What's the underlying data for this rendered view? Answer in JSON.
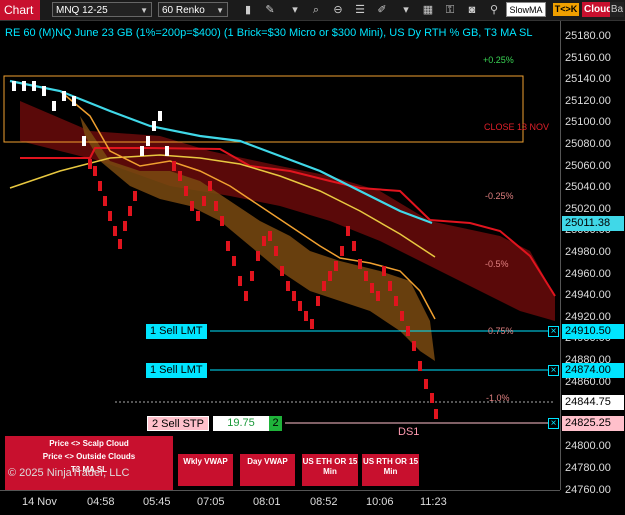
{
  "toolbar": {
    "chart_label": "Chart",
    "instrument": "MNQ 12-25",
    "interval": "60 Renko",
    "slow_ma": "SlowMA",
    "tck_button": "T<>K",
    "cloud_button": "Cloud",
    "last_tag": "Ba",
    "icons": [
      "magnify-icon",
      "zoom-in-icon",
      "zoom-out-icon",
      "bar-style-icon",
      "pencil-icon",
      "template-icon",
      "properties-icon",
      "lock-icon",
      "camera-icon",
      "link-icon"
    ]
  },
  "chart": {
    "title": "RE 60 (M)NQ June 23 GB (1%=200p=$400) (1 Brick=$30 Micro or $300 Mini), US Dy RTH % GB, T3 MA SL",
    "pct_labels": [
      {
        "text": "+0.25%",
        "color": "#39d353"
      },
      {
        "text": "-0.25%",
        "color": "#e08080"
      },
      {
        "text": "-0.5%",
        "color": "#e08080"
      },
      {
        "text": "0.75%",
        "color": "#e08080"
      },
      {
        "text": "-1.0%",
        "color": "#e08080"
      }
    ],
    "close_label": "CLOSE 13 NOV",
    "ds_label": "DS1",
    "orders": {
      "sell1": "1 Sell LMT",
      "sell2": "1 Sell LMT",
      "stop": "2 Sell STP",
      "stop_value": "19.75",
      "stop_qty": "2"
    },
    "red_panel": {
      "line1": "Price <> Scalp Cloud",
      "line2": "Price <> Outside Clouds",
      "line3": "T3 MA SL"
    },
    "copyright": "© 2025 NinjaTrader, LLC",
    "buttons": [
      "Wkly VWAP",
      "Day VWAP",
      "US ETH OR 15 Min",
      "US RTH OR 15 Min"
    ]
  },
  "price_axis": {
    "labels": [
      "25180.00",
      "25160.00",
      "25140.00",
      "25120.00",
      "25100.00",
      "25080.00",
      "25060.00",
      "25040.00",
      "25020.00",
      "25000.00",
      "24980.00",
      "24960.00",
      "24940.00",
      "24920.00",
      "24900.00",
      "24880.00",
      "24860.00",
      "24840.00",
      "24820.00",
      "24800.00",
      "24780.00",
      "24760.00"
    ],
    "tags": {
      "t1": "25011.38",
      "t2": "24910.50",
      "t3": "24874.00",
      "t4": "24844.75",
      "t5": "24825.25"
    }
  },
  "time_axis": {
    "labels": [
      "14 Nov",
      "04:58",
      "05:45",
      "07:05",
      "08:01",
      "08:52",
      "10:06",
      "11:23"
    ]
  },
  "colors": {
    "bull_brick": "#ffffff",
    "bear_brick": "#e0141e",
    "fast_ma": "#40d8e8",
    "slow_ma": "#e8c840",
    "t3_ma": "#f0a030",
    "cloud_red": "#6a0a0a",
    "cloud_orange": "#7a4a10",
    "order_cyan": "#00e5ff",
    "stop_pink": "#ffc0cb"
  }
}
